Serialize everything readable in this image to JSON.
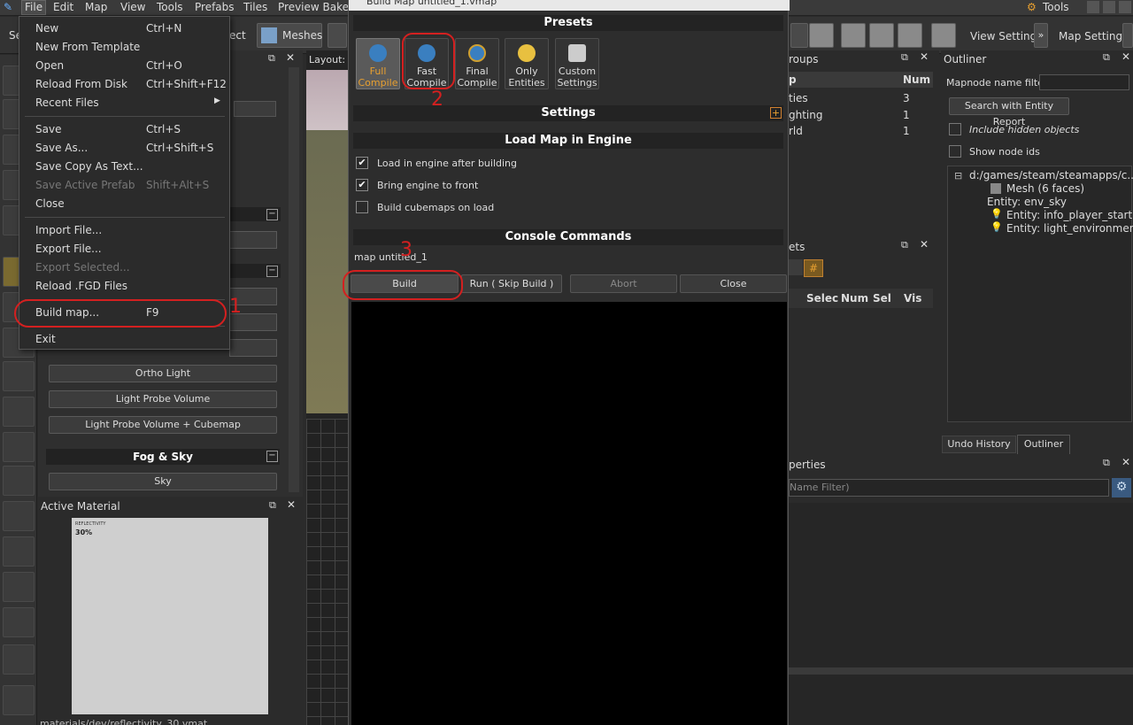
{
  "menubar": {
    "items": [
      "File",
      "Edit",
      "Map",
      "View",
      "Tools",
      "Prefabs",
      "Tiles",
      "Preview Baked"
    ],
    "tools_label": "Tools"
  },
  "toolbar": {
    "meshes_label": "Meshes",
    "partial_label": "ect",
    "view_settings_label": "View Settings:",
    "map_settings_label": "Map Settings:",
    "left_stub": "Se"
  },
  "file_menu": {
    "items": [
      {
        "label": "New",
        "shortcut": "Ctrl+N",
        "enabled": true
      },
      {
        "label": "New From Template",
        "shortcut": "",
        "enabled": true
      },
      {
        "label": "Open",
        "shortcut": "Ctrl+O",
        "enabled": true
      },
      {
        "label": "Reload From Disk",
        "shortcut": "Ctrl+Shift+F12",
        "enabled": true
      },
      {
        "label": "Recent Files",
        "shortcut": "",
        "enabled": true
      },
      {
        "label": "Save",
        "shortcut": "Ctrl+S",
        "enabled": true
      },
      {
        "label": "Save As...",
        "shortcut": "Ctrl+Shift+S",
        "enabled": true
      },
      {
        "label": "Save Copy As Text...",
        "shortcut": "",
        "enabled": true
      },
      {
        "label": "Save Active Prefab",
        "shortcut": "Shift+Alt+S",
        "enabled": false
      },
      {
        "label": "Close",
        "shortcut": "",
        "enabled": true
      },
      {
        "label": "Import File...",
        "shortcut": "",
        "enabled": true
      },
      {
        "label": "Export File...",
        "shortcut": "",
        "enabled": true
      },
      {
        "label": "Export Selected...",
        "shortcut": "",
        "enabled": false
      },
      {
        "label": "Reload .FGD Files",
        "shortcut": "",
        "enabled": true
      },
      {
        "label": "Build map...",
        "shortcut": "F9",
        "enabled": true
      },
      {
        "label": "Exit",
        "shortcut": "",
        "enabled": true
      }
    ]
  },
  "left_panel": {
    "layout_label": "Layout:",
    "buttons": [
      "Ortho Light",
      "Light Probe Volume",
      "Light Probe Volume  + Cubemap"
    ],
    "fog_sky_header": "Fog & Sky",
    "sky_button": "Sky"
  },
  "active_material": {
    "title": "Active Material",
    "thumb_label": "REFLECTIVITY",
    "thumb_value": "30%",
    "path": "materials/dev/reflectivity_30.vmat"
  },
  "build_dialog": {
    "title": "Build Map untitled_1.vmap",
    "presets_header": "Presets",
    "presets": [
      {
        "line1": "Full",
        "line2": "Compile",
        "selected": true,
        "color": "#3a7fc0"
      },
      {
        "line1": "Fast",
        "line2": "Compile",
        "selected": false,
        "color": "#3a7fc0"
      },
      {
        "line1": "Final",
        "line2": "Compile",
        "selected": false,
        "color": "#3a7fc0"
      },
      {
        "line1": "Only",
        "line2": "Entities",
        "selected": false,
        "color": "#e8c040"
      },
      {
        "line1": "Custom",
        "line2": "Settings",
        "selected": false,
        "color": "#cccccc"
      }
    ],
    "settings_header": "Settings",
    "load_header": "Load Map in Engine",
    "options": [
      {
        "label": "Load in engine after building",
        "checked": true
      },
      {
        "label": "Bring engine to front",
        "checked": true
      },
      {
        "label": "Build cubemaps on load",
        "checked": false
      }
    ],
    "console_header": "Console Commands",
    "console_command": "map untitled_1",
    "buttons": {
      "build": "Build",
      "run": "Run ( Skip Build )",
      "abort": "Abort",
      "close": "Close"
    }
  },
  "groups_panel": {
    "title": "roups",
    "col_name": "p",
    "col_num": "Num",
    "rows": [
      {
        "name": "ties",
        "num": "3"
      },
      {
        "name": "ghting",
        "num": "1"
      },
      {
        "name": "rld",
        "num": "1"
      }
    ]
  },
  "sets_panel": {
    "title": "ets",
    "cols": [
      "Selec",
      "Num",
      "Sel",
      "Vis"
    ]
  },
  "outliner": {
    "title": "Outliner",
    "filter_label": "Mapnode name filter",
    "search_button": "Search with Entity Report",
    "include_hidden": "Include hidden objects",
    "show_node_ids": "Show node ids",
    "tree": [
      {
        "label": "d:/games/steam/steamapps/c...",
        "depth": 0
      },
      {
        "label": "Mesh (6 faces)",
        "depth": 1
      },
      {
        "label": "Entity: env_sky",
        "depth": 1
      },
      {
        "label": "Entity: info_player_start",
        "depth": 2
      },
      {
        "label": "Entity: light_environment",
        "depth": 2
      }
    ],
    "tabs": [
      "Undo History",
      "Outliner"
    ]
  },
  "properties_panel": {
    "title": "perties",
    "filter_placeholder": "Name Filter)"
  },
  "annotations": [
    "1",
    "2",
    "3"
  ],
  "colors": {
    "annotation_red": "#d42020",
    "selected_preset_text": "#e8a030"
  }
}
